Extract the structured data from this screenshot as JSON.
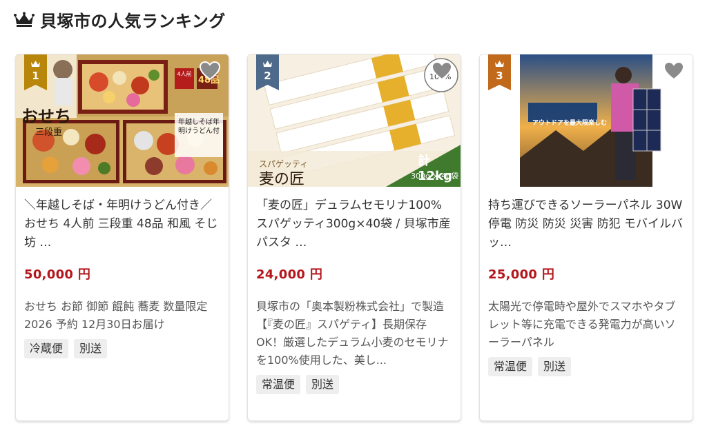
{
  "section": {
    "title": "貝塚市の人気ランキング",
    "icon": "crown-icon"
  },
  "colors": {
    "price": "#b4161b",
    "rank1": "#b8860b",
    "rank2": "#4e6a8a",
    "rank3": "#c26a1c"
  },
  "products": [
    {
      "rank": "1",
      "name": "＼年越しそば・年明けうどん付き／ おせち 4人前 三段重 48品 和風 そじ坊 …",
      "price": "50,000 円",
      "description": "おせち お節 御節 餛飩 蕎麦 数量限定 2026 予約 12月30日お届け",
      "tags": [
        "冷蔵便",
        "別送"
      ],
      "image": {
        "text_main": "おせち",
        "text_sub": "三段重",
        "badge_people": "4人前",
        "badge_items": "48品",
        "text_side": "年越しそば年明けうどん付"
      }
    },
    {
      "rank": "2",
      "name": "「麦の匠」デュラムセモリナ100% スパゲッティ300g×40袋 / 貝塚市産パスタ …",
      "price": "24,000 円",
      "description": "貝塚市の「奥本製粉株式会社」で製造【『麦の匠』スパゲティ】長期保存OK！厳選したデュラム小麦のセモリナを100%使用した、美し...",
      "tags": [
        "常温便",
        "別送"
      ],
      "image": {
        "brand": "麦の匠",
        "kind": "スパゲッティ",
        "total": "計12kg",
        "pack": "300g × 40袋",
        "badge": "100%"
      }
    },
    {
      "rank": "3",
      "name": "持ち運びできるソーラーパネル 30W 停電 防災 防災 災害 防犯 モバイルバッ…",
      "price": "25,000 円",
      "description": "太陽光で停電時や屋外でスマホやタブレット等に充電できる発電力が高いソーラーパネル",
      "tags": [
        "常温便",
        "別送"
      ],
      "image": {
        "banner": "アウトドアを最大限楽しむ"
      }
    }
  ]
}
